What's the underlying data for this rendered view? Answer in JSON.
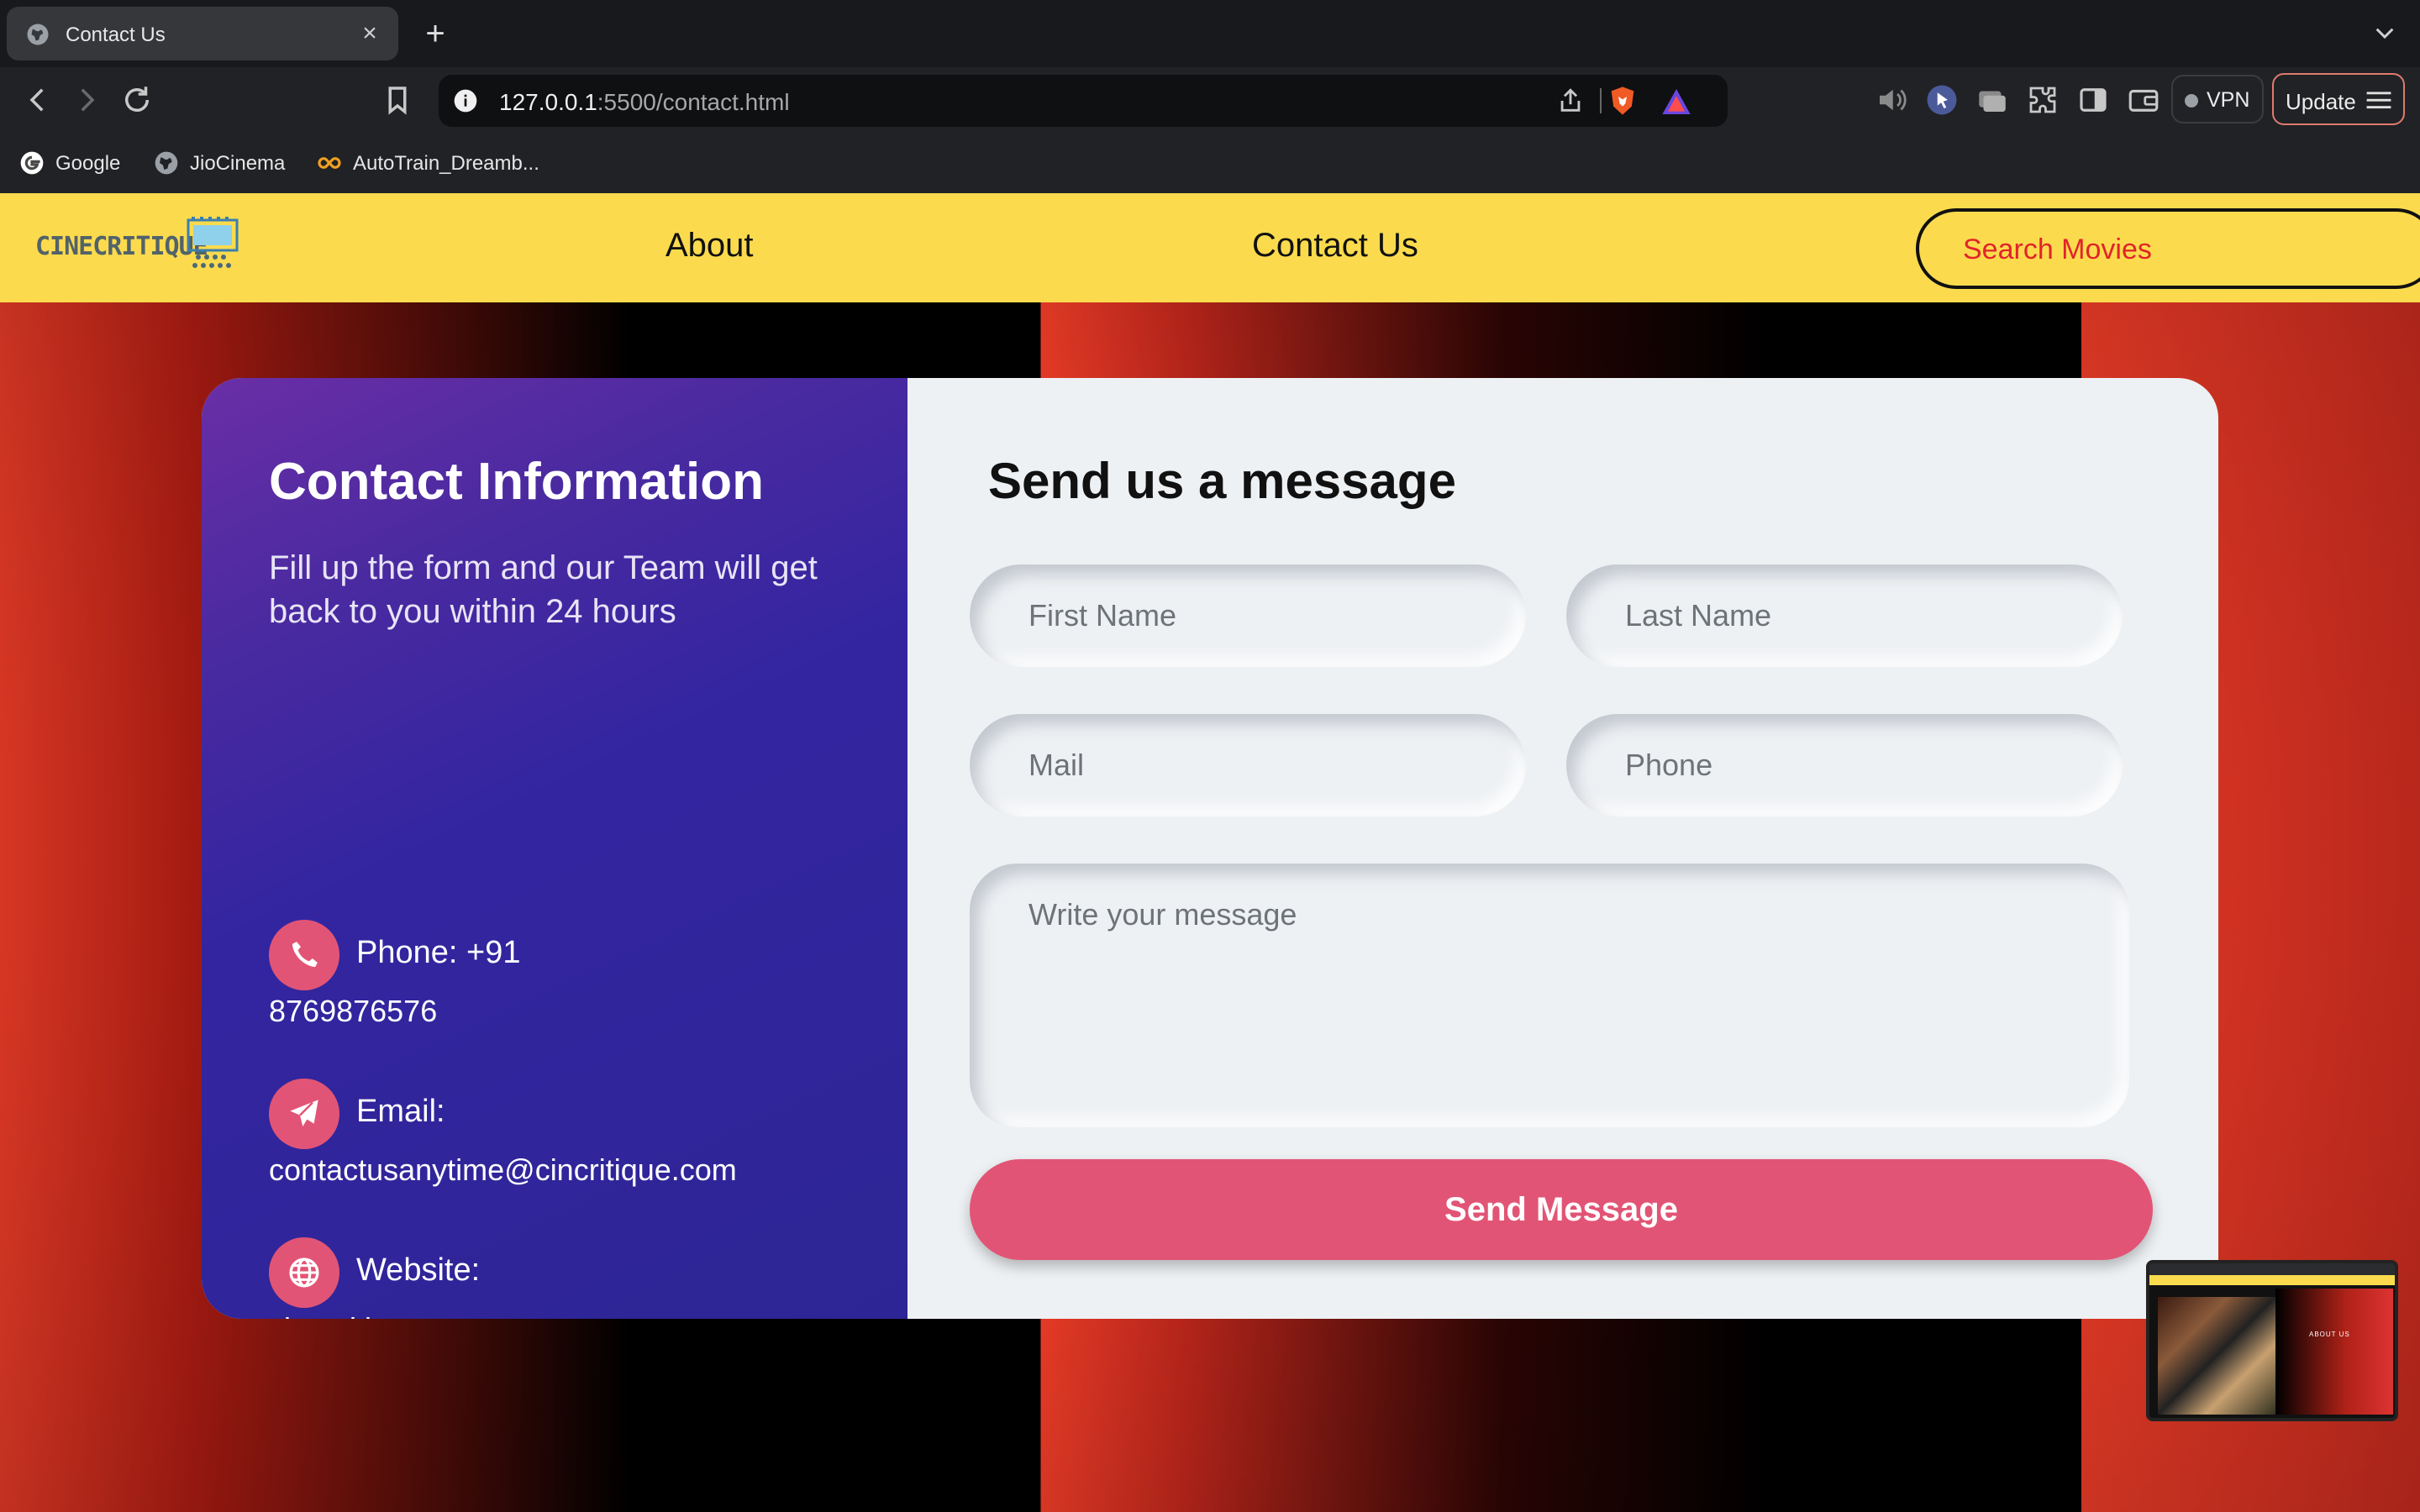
{
  "browser": {
    "tab_title": "Contact Us",
    "url_host": "127.0.0.1",
    "url_rest": ":5500/contact.html",
    "vpn_label": "VPN",
    "update_label": "Update",
    "bookmarks": [
      {
        "label": "Google",
        "icon": "google-icon"
      },
      {
        "label": "JioCinema",
        "icon": "globe-icon"
      },
      {
        "label": "AutoTrain_Dreamb...",
        "icon": "infinity-icon"
      }
    ]
  },
  "navbar": {
    "logo_text": "CINECRITIQUE",
    "links": [
      "About",
      "Contact Us"
    ],
    "search_label": "Search Movies"
  },
  "info": {
    "title": "Contact Information",
    "description": "Fill up the form and our Team will get back to you within 24 hours",
    "items": [
      {
        "label": "Phone: +91",
        "value": "8769876576",
        "icon": "phone-icon"
      },
      {
        "label": "Email:",
        "value": "contactusanytime@cincritique.com",
        "icon": "paper-plane-icon"
      },
      {
        "label": "Website:",
        "value": "cinecritique.com",
        "icon": "globe-icon"
      }
    ]
  },
  "form": {
    "title": "Send us a message",
    "first_name_placeholder": "First Name",
    "last_name_placeholder": "Last Name",
    "mail_placeholder": "Mail",
    "phone_placeholder": "Phone",
    "message_placeholder": "Write your message",
    "submit_label": "Send Message"
  },
  "pip": {
    "caption": "ABOUT US"
  },
  "colors": {
    "navbar_bg": "#fbdb4d",
    "accent_pink": "#e25475",
    "search_text": "#e0242a",
    "info_gradient_start": "#6a2ea6",
    "info_gradient_end": "#2d2595"
  }
}
